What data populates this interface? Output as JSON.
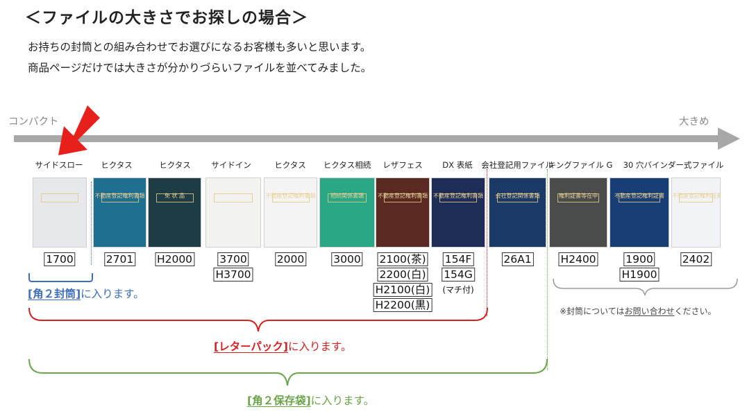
{
  "heading": {
    "title": "＜ファイルの大きさでお探しの場合＞",
    "intro_line1": "お持ちの封筒との組み合わせでお選びになるお客様も多いと思います。",
    "intro_line2": "商品ページだけでは大きさが分かりづらいファイルを並べてみました。"
  },
  "scale": {
    "compact_label": "コンパクト",
    "large_label": "大きめ",
    "bar_color": "#a7a7a7",
    "pointer_color": "#e8201c"
  },
  "products": [
    {
      "name": "サイドスロー",
      "cover_color": "#e6e8ec",
      "cover_text": "",
      "codes": [
        "1700"
      ]
    },
    {
      "name": "ヒクタス",
      "cover_color": "#1f6f91",
      "cover_text": "不動産登記権利書類",
      "codes": [
        "2701"
      ]
    },
    {
      "name": "ヒクタス",
      "cover_color": "#1d3c44",
      "cover_text": "免 状 品",
      "codes": [
        "H2000"
      ]
    },
    {
      "name": "サイドイン",
      "cover_color": "#f2f2f0",
      "cover_text": "",
      "codes": [
        "3700",
        "H3700"
      ]
    },
    {
      "name": "ヒクタス",
      "cover_color": "#f4f4f4",
      "cover_text": "不動産登記権利書類",
      "codes": [
        "2000"
      ]
    },
    {
      "name": "ヒクタス相続",
      "cover_color": "#2aa886",
      "cover_text": "相続関係書類",
      "codes": [
        "3000"
      ]
    },
    {
      "name": "レザフェス",
      "cover_color": "#5a2a22",
      "cover_text": "不動産登記権利書類",
      "codes": [
        "2100(茶)",
        "2200(白)",
        "H2100(白)",
        "H2200(黒)"
      ]
    },
    {
      "name": "DX 表紙",
      "cover_color": "#1e2d57",
      "cover_text": "不動産登記権利書類",
      "codes": [
        "154F",
        "154G"
      ],
      "note": "(マチ付)"
    },
    {
      "name": "会社登記用ファイル",
      "cover_color": "#1c3a66",
      "cover_text": "会社登記関係書類",
      "codes": [
        "26A1"
      ]
    },
    {
      "name": "キングファイル G",
      "cover_color": "#4a4c4c",
      "cover_text": "権利証書等在中",
      "codes": [
        "H2400"
      ]
    },
    {
      "name": "30 穴バインダー式ファイル",
      "cover_color": "#183f75",
      "cover_text": "不動産登記権利証書",
      "codes": [
        "1900",
        "H1900"
      ]
    },
    {
      "name": "",
      "cover_color": "#f1f3f6",
      "cover_text": "不動産登記権利証書",
      "codes": [
        "2402"
      ]
    }
  ],
  "envelopes": {
    "kaku2": {
      "bracket": "[角２封筒]",
      "suffix": "に入ります。",
      "color": "#3d6fb8"
    },
    "letterpack": {
      "bracket": "[レターパック]",
      "suffix": "に入ります。",
      "color": "#d42020"
    },
    "kaku2hozon": {
      "bracket": "[角２保存袋]",
      "suffix": "に入ります。",
      "color": "#6aa34a"
    },
    "other": {
      "prefix": "※封筒については",
      "link": "お問い合わせ",
      "suffix": "ください。",
      "color": "#888888"
    }
  }
}
